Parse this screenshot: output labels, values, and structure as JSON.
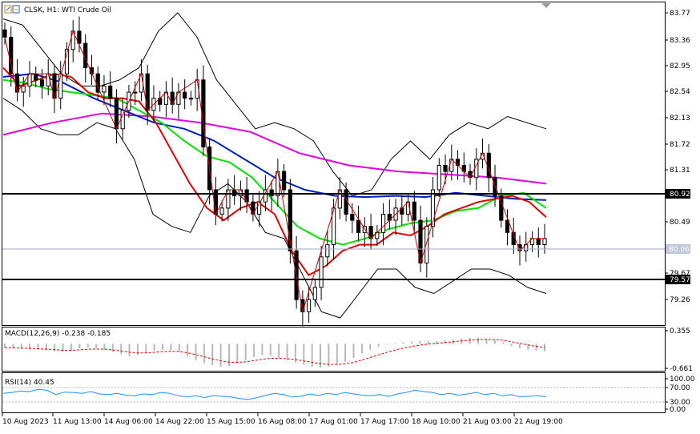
{
  "header": {
    "symbol": "CLSK, H1: WTI Crude Oil"
  },
  "main_panel": {
    "price_ticks": [
      "83.77",
      "83.36",
      "82.95",
      "82.54",
      "82.13",
      "81.72",
      "81.31",
      "80.49",
      "79.67",
      "79.26"
    ],
    "horizontal_levels": [
      "80.92",
      "79.57"
    ],
    "current_price": "80.06",
    "ylim": [
      78.9,
      83.9
    ]
  },
  "macd_panel": {
    "label": "MACD(12,26,9) -0.238 -0.185",
    "ticks": [
      "0.355",
      "-0.661"
    ]
  },
  "rsi_panel": {
    "label": "RSI(14) 40.45",
    "ticks": [
      "100.00",
      "70.00",
      "30.00",
      "0.00"
    ]
  },
  "time_axis": {
    "labels": [
      "10 Aug 2023",
      "11 Aug 13:00",
      "14 Aug 06:00",
      "14 Aug 22:00",
      "15 Aug 15:00",
      "16 Aug 08:00",
      "17 Aug 01:00",
      "17 Aug 17:00",
      "18 Aug 10:00",
      "21 Aug 03:00",
      "21 Aug 19:00"
    ]
  },
  "colors": {
    "ma_fast": "#e00000",
    "ma_medium": "#00e000",
    "ma_slow": "#0020c0",
    "ma_long": "#e000e0",
    "bollinger": "#000000",
    "zigzag": "#cc0000",
    "levels": "#000000"
  },
  "chart_data": [
    {
      "type": "line",
      "name": "main",
      "ylim": [
        78.9,
        83.9
      ],
      "series": [
        {
          "key": "close",
          "values": [
            83.5,
            82.9,
            82.6,
            82.7,
            82.9,
            82.8,
            82.7,
            82.9,
            82.5,
            82.9,
            83.3,
            83.6,
            83.4,
            83.0,
            82.9,
            82.6,
            82.7,
            82.5,
            82.0,
            82.3,
            82.6,
            82.6,
            82.9,
            82.3,
            82.5,
            82.4,
            82.6,
            82.4,
            82.6,
            82.5,
            82.5,
            82.8,
            81.7,
            81.0,
            80.6,
            80.7,
            81.0,
            80.9,
            81.0,
            80.8,
            80.6,
            80.8,
            81.0,
            80.9,
            81.3,
            81.0,
            80.0,
            79.2,
            79.0,
            79.2,
            79.4,
            79.9,
            80.1,
            80.7,
            81.0,
            80.6,
            80.5,
            80.3,
            80.4,
            80.2,
            80.3,
            80.6,
            80.5,
            80.7,
            80.6,
            80.8,
            80.5,
            79.8,
            80.4,
            81.0,
            81.4,
            81.3,
            81.5,
            81.4,
            81.3,
            81.2,
            81.5,
            81.6,
            81.2,
            80.9,
            80.5,
            80.3,
            80.1,
            80.0,
            80.1,
            80.2,
            80.1,
            80.2
          ]
        },
        {
          "key": "ma_fast",
          "values": [
            83.0,
            82.7,
            82.8,
            82.9,
            82.85,
            82.6,
            82.5,
            82.5,
            82.45,
            82.1,
            81.6,
            81.1,
            80.7,
            80.5,
            80.7,
            80.8,
            80.6,
            80.0,
            79.6,
            79.75,
            80.0,
            80.1,
            80.1,
            80.3,
            80.25,
            80.4,
            80.6,
            80.7,
            80.8,
            80.85,
            80.9,
            80.8,
            80.55
          ]
        },
        {
          "key": "ma_medium",
          "values": [
            82.8,
            82.75,
            82.65,
            82.6,
            82.55,
            82.5,
            82.3,
            82.1,
            81.8,
            81.55,
            81.45,
            81.2,
            80.8,
            80.4,
            80.2,
            80.1,
            80.2,
            80.35,
            80.45,
            80.5,
            80.65,
            80.7,
            80.9,
            80.95,
            80.7
          ]
        },
        {
          "key": "ma_slow",
          "values": [
            82.85,
            82.9,
            82.75,
            82.5,
            82.3,
            82.1,
            82.0,
            81.8,
            81.5,
            81.2,
            81.0,
            80.9,
            80.88,
            80.9,
            80.88,
            80.95,
            80.9,
            80.85,
            80.83
          ]
        },
        {
          "key": "ma_long",
          "values": [
            81.9,
            82.1,
            82.25,
            82.2,
            82.1,
            81.95,
            81.6,
            81.4,
            81.3,
            81.25,
            81.2,
            81.1
          ]
        },
        {
          "key": "bb_upper",
          "values": [
            83.8,
            83.7,
            83.3,
            82.9,
            82.7,
            82.7,
            82.8,
            83.0,
            83.6,
            83.9,
            83.5,
            82.8,
            82.4,
            82.0,
            82.1,
            82.0,
            81.8,
            81.3,
            80.9,
            81.0,
            81.5,
            81.8,
            81.5,
            81.9,
            82.1,
            82.0,
            82.2,
            82.1,
            82.0
          ]
        },
        {
          "key": "bb_lower",
          "values": [
            82.5,
            82.3,
            82.0,
            81.9,
            81.9,
            82.1,
            82.0,
            81.5,
            80.6,
            80.4,
            80.3,
            80.9,
            81.1,
            80.8,
            80.3,
            80.2,
            79.6,
            79.0,
            78.9,
            79.3,
            79.7,
            79.7,
            79.4,
            79.3,
            79.5,
            79.7,
            79.7,
            79.6,
            79.4,
            79.3
          ]
        }
      ]
    },
    {
      "type": "bar",
      "name": "MACD(12,26,9)",
      "ylim": [
        -0.661,
        0.355
      ],
      "values": [
        -0.1,
        -0.12,
        -0.14,
        -0.15,
        -0.16,
        -0.18,
        -0.2,
        -0.22,
        -0.18,
        -0.12,
        -0.1,
        -0.12,
        -0.16,
        -0.22,
        -0.28,
        -0.33,
        -0.3,
        -0.24,
        -0.18,
        -0.16,
        -0.18,
        -0.22,
        -0.34,
        -0.44,
        -0.52,
        -0.58,
        -0.62,
        -0.6,
        -0.52,
        -0.44,
        -0.36,
        -0.3,
        -0.32,
        -0.38,
        -0.44,
        -0.5,
        -0.56,
        -0.62,
        -0.64,
        -0.62,
        -0.56,
        -0.48,
        -0.38,
        -0.26,
        -0.16,
        -0.08,
        -0.02,
        0.02,
        0.04,
        0.06,
        0.08,
        0.08,
        0.07,
        0.1,
        0.12,
        0.15,
        0.16,
        0.16,
        0.14,
        0.1,
        0.04,
        -0.06,
        -0.12,
        -0.16,
        -0.18,
        -0.2
      ]
    },
    {
      "type": "line",
      "name": "RSI(14)",
      "ylim": [
        0,
        100
      ],
      "values": [
        52,
        55,
        60,
        58,
        65,
        62,
        48,
        56,
        55,
        52,
        58,
        50,
        48,
        52,
        46,
        44,
        50,
        48,
        55,
        52,
        44,
        40,
        44,
        38,
        45,
        42,
        40,
        35,
        32,
        38,
        46,
        52,
        48,
        40,
        42,
        50,
        45,
        52,
        48,
        55,
        50,
        46,
        44,
        48,
        42,
        50,
        55,
        62,
        58,
        55,
        48,
        52,
        46,
        50,
        55,
        48,
        52,
        44,
        48,
        40,
        42,
        45,
        40
      ]
    }
  ]
}
